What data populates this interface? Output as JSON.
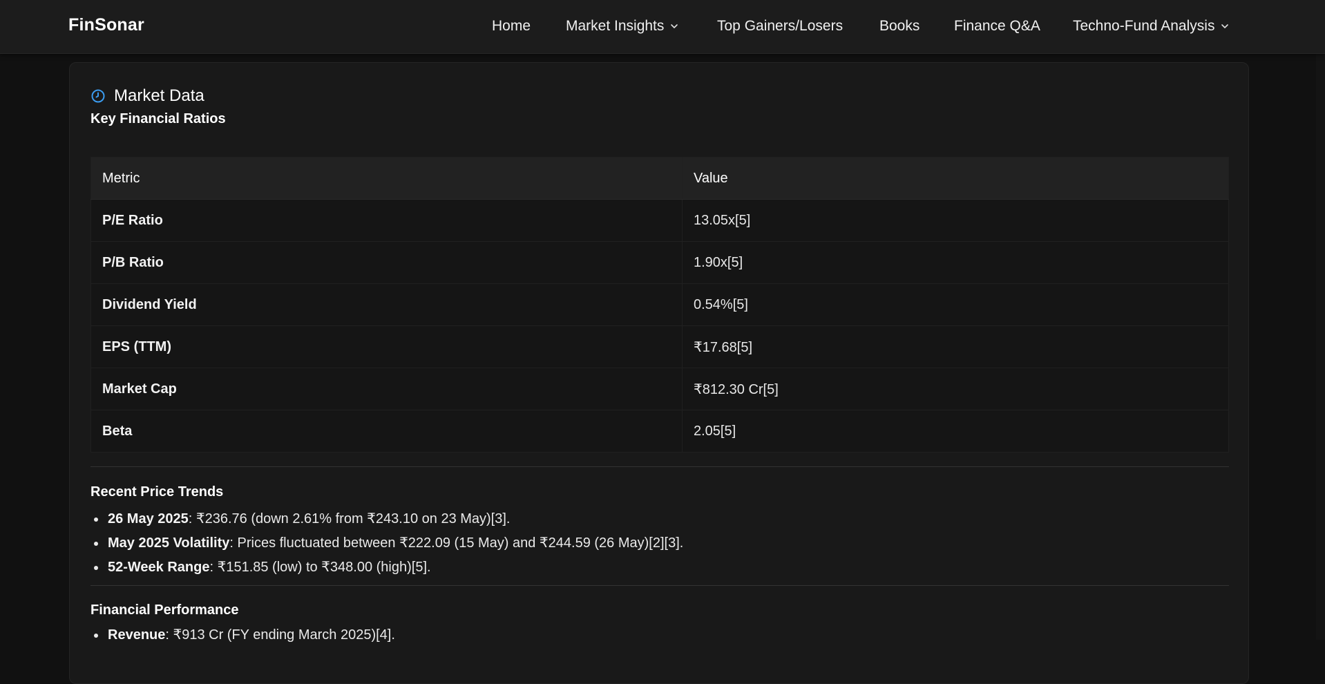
{
  "nav": {
    "brand": "FinSonar",
    "links": [
      {
        "label": "Home",
        "has_dropdown": false
      },
      {
        "label": "Market Insights",
        "has_dropdown": true
      },
      {
        "label": "Top Gainers/Losers",
        "has_dropdown": false
      },
      {
        "label": "Books",
        "has_dropdown": false
      },
      {
        "label": "Finance Q&A",
        "has_dropdown": false
      },
      {
        "label": "Techno-Fund Analysis",
        "has_dropdown": true
      }
    ]
  },
  "section": {
    "icon": "clock-icon",
    "title": "Market Data"
  },
  "ratios": {
    "heading": "Key Financial Ratios",
    "columns": [
      "Metric",
      "Value"
    ],
    "rows": [
      {
        "metric": "P/E Ratio",
        "value": "13.05x[5]"
      },
      {
        "metric": "P/B Ratio",
        "value": "1.90x[5]"
      },
      {
        "metric": "Dividend Yield",
        "value": "0.54%[5]"
      },
      {
        "metric": "EPS (TTM)",
        "value": "₹17.68[5]"
      },
      {
        "metric": "Market Cap",
        "value": "₹812.30 Cr[5]"
      },
      {
        "metric": "Beta",
        "value": "2.05[5]"
      }
    ]
  },
  "trends": {
    "heading": "Recent Price Trends",
    "items": [
      {
        "label": "26 May 2025",
        "text": ": ₹236.76 (down 2.61% from ₹243.10 on 23 May)[3]."
      },
      {
        "label": "May 2025 Volatility",
        "text": ": Prices fluctuated between ₹222.09 (15 May) and ₹244.59 (26 May)[2][3]."
      },
      {
        "label": "52-Week Range",
        "text": ": ₹151.85 (low) to ₹348.00 (high)[5]."
      }
    ]
  },
  "performance": {
    "heading": "Financial Performance",
    "items": [
      {
        "label": "Revenue",
        "text": ": ₹913 Cr (FY ending March 2025)[4]."
      }
    ]
  },
  "colors": {
    "accent": "#3b9cf0",
    "background": "#111111",
    "card": "#191919",
    "navbar": "#1c1c1c"
  }
}
